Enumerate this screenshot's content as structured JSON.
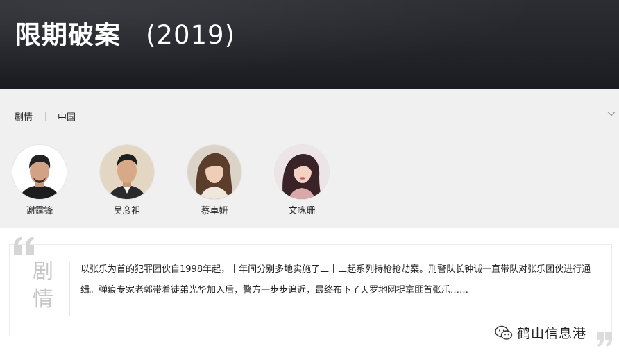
{
  "header": {
    "title": "限期破案",
    "year": "(2019)"
  },
  "info": {
    "tags": [
      "剧情",
      "中国"
    ]
  },
  "cast": [
    {
      "name": "谢霆锋",
      "icon": "actor-portrait-icon"
    },
    {
      "name": "吴彦祖",
      "icon": "actor-portrait-icon"
    },
    {
      "name": "蔡卓妍",
      "icon": "actress-portrait-icon"
    },
    {
      "name": "文咏珊",
      "icon": "actress-portrait-icon"
    }
  ],
  "plot": {
    "label_line1": "剧",
    "label_line2": "情",
    "text": "以张乐为首的犯罪团伙自1998年起，十年间分别多地实施了二十二起系列持枪抢劫案。刑警队长钟诚一直带队对张乐团伙进行通缉。弹痕专家老郭带着徒弟光华加入后，警方一步步追近，最终布下了天罗地网捉拿匪首张乐……"
  },
  "watermark": {
    "text": "鹤山信息港",
    "icon": "wechat-icon"
  },
  "colors": {
    "hero_bg": "#23242a",
    "panel_bg": "#f0f0f0",
    "plot_label": "#c7c7c7"
  }
}
